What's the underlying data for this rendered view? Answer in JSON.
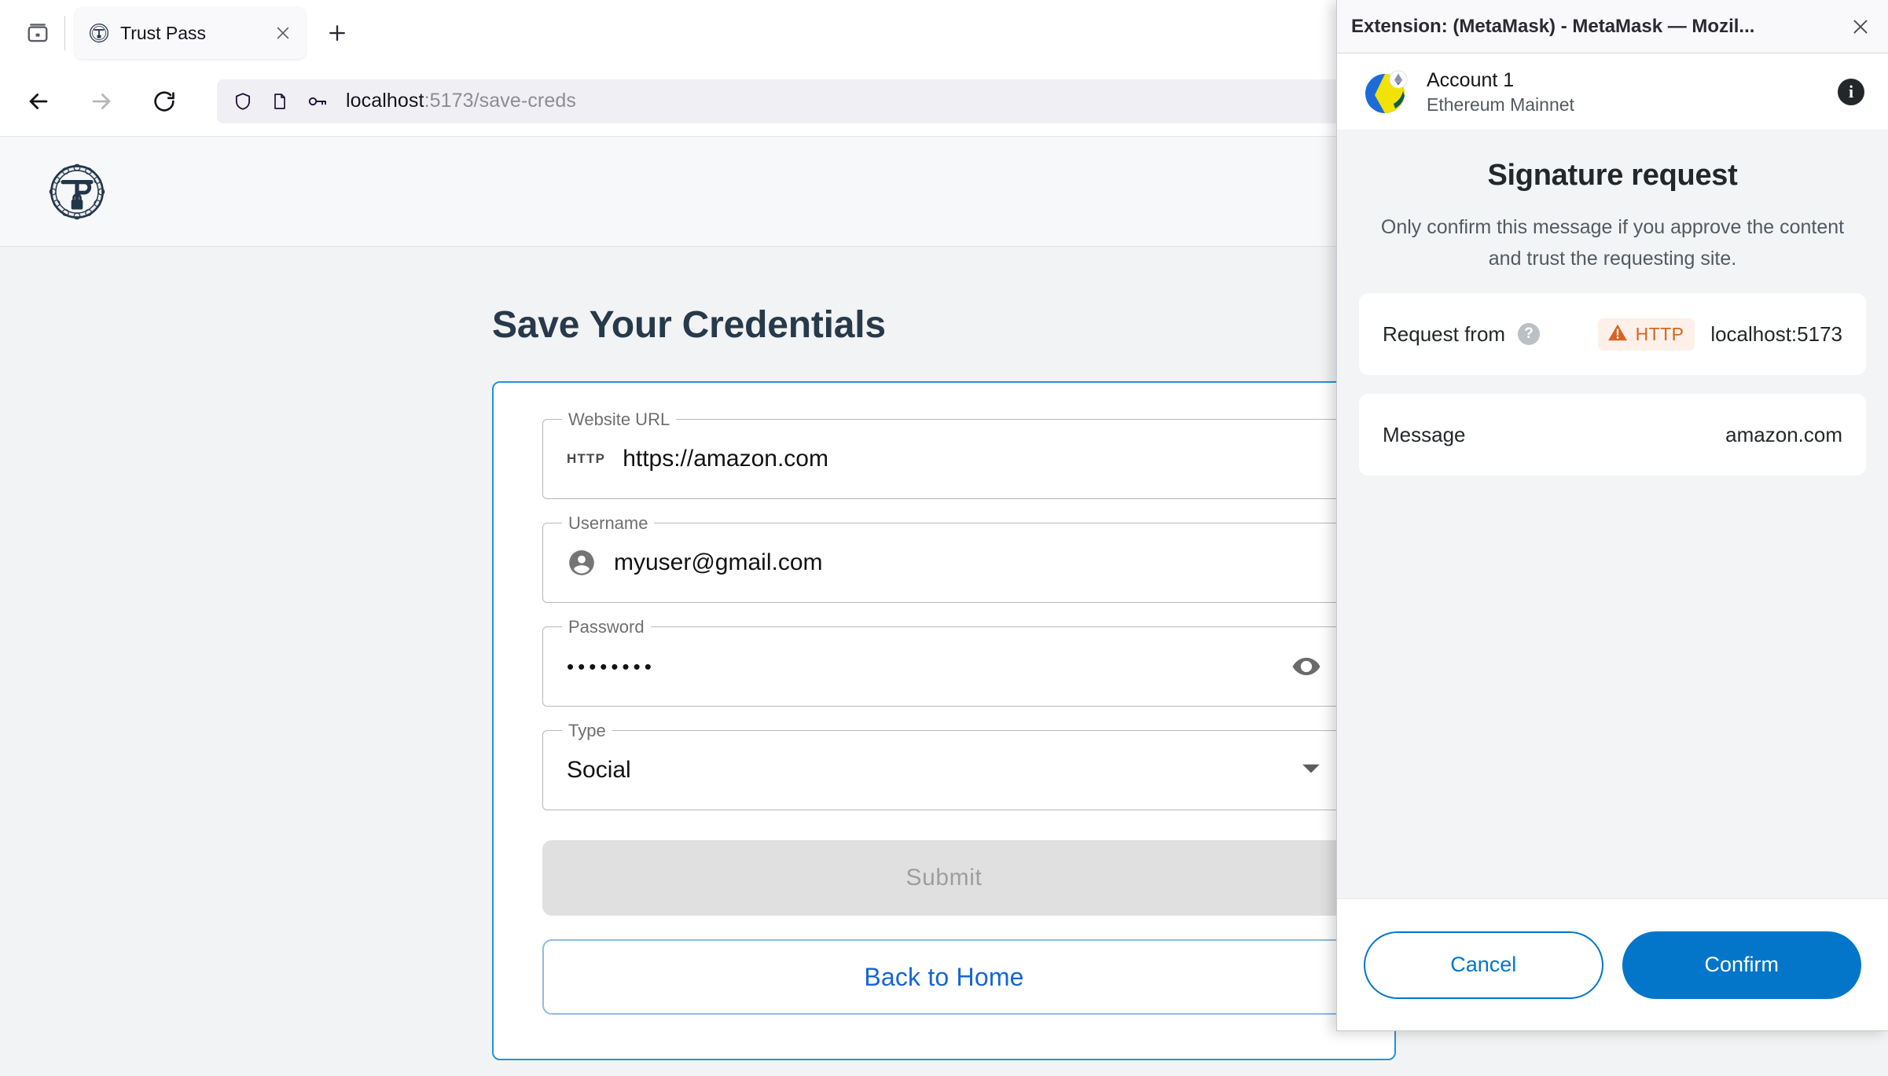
{
  "browser": {
    "tab": {
      "title": "Trust Pass",
      "favicon_icon": "trust-pass-emblem-icon",
      "close_icon": "close-icon"
    },
    "tab_list_icon": "tab-list-icon",
    "new_tab_icon": "plus-icon",
    "nav": {
      "back_icon": "arrow-left-icon",
      "forward_icon": "arrow-right-icon",
      "reload_icon": "reload-icon"
    },
    "urlbar": {
      "shield_icon": "shield-icon",
      "page_icon": "page-document-icon",
      "key_icon": "key-icon",
      "url_host": "localhost",
      "url_rest": ":5173/save-creds"
    }
  },
  "app": {
    "logo_icon": "trust-pass-logo-icon",
    "header_button_label": "",
    "title": "Save Your Credentials",
    "fields": [
      {
        "legend": "Website URL",
        "adornment": "HTTP",
        "adornment_icon": "http-text-adornment",
        "value": "https://amazon.com",
        "name": "website-url"
      },
      {
        "legend": "Username",
        "adornment": "",
        "adornment_icon": "account-circle-icon",
        "value": "myuser@gmail.com",
        "name": "username"
      },
      {
        "legend": "Password",
        "adornment": "",
        "adornment_icon": "",
        "value": "••••••••",
        "trailing_icon": "eye-visibility-icon",
        "name": "password"
      },
      {
        "legend": "Type",
        "adornment": "",
        "adornment_icon": "",
        "value": "Social",
        "caret_icon": "chevron-down-icon",
        "name": "type"
      }
    ],
    "submit_label": "Submit",
    "back_home_label": "Back to Home"
  },
  "metamask": {
    "window_title": "Extension: (MetaMask) - MetaMask — Mozil...",
    "close_icon": "close-icon",
    "account": {
      "name": "Account 1",
      "network": "Ethereum Mainnet",
      "avatar_icon": "metamask-account-avatar-icon",
      "info_icon": "info-icon"
    },
    "heading": "Signature request",
    "subtitle": "Only confirm this message if you approve the content and trust the requesting site.",
    "rows": [
      {
        "label": "Request from",
        "help_icon": "question-mark-icon",
        "badge_text": "HTTP",
        "badge_icon": "warning-triangle-icon",
        "value": "localhost:5173"
      },
      {
        "label": "Message",
        "help_icon": "",
        "badge_text": "",
        "badge_icon": "",
        "value": "amazon.com"
      }
    ],
    "cancel_label": "Cancel",
    "confirm_label": "Confirm",
    "colors": {
      "primary": "#0376c9",
      "warning": "#d0671f",
      "warning_bg": "#fdf0e9",
      "body_bg": "#f2f4f6"
    }
  }
}
